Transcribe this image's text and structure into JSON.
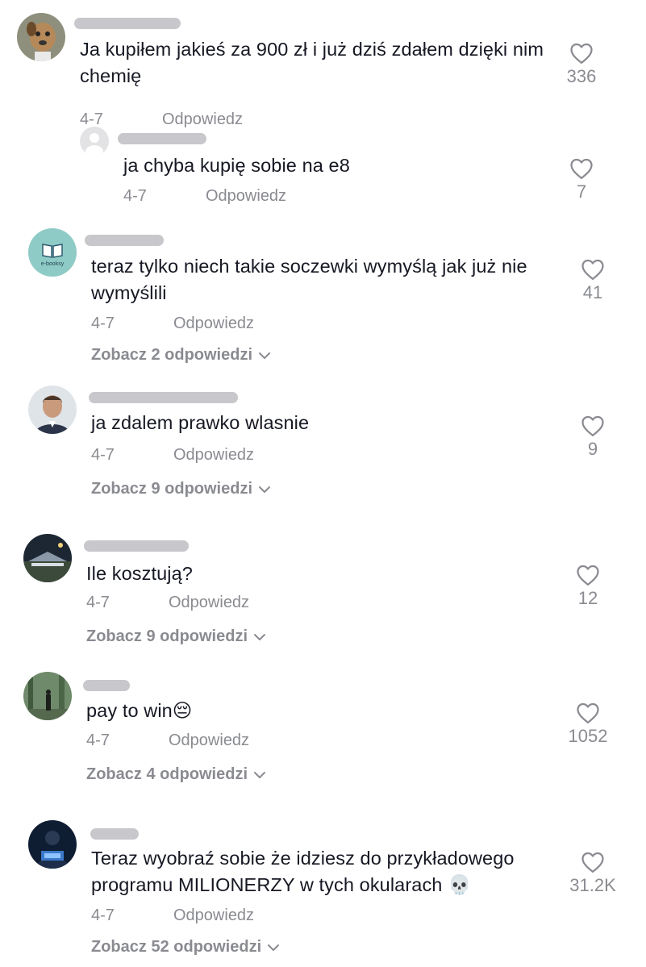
{
  "comments": [
    {
      "text": "Ja kupiłem jakieś za 900 zł i już dziś zdałem dzięki nim chemię",
      "date": "4-7",
      "reply_label": "Odpowiedz",
      "likes": "336",
      "replies": [
        {
          "text": "ja chyba kupię sobie na e8",
          "date": "4-7",
          "reply_label": "Odpowiedz",
          "likes": "7"
        }
      ]
    },
    {
      "text": "teraz tylko niech takie soczewki wymyślą jak już nie wymyślili",
      "date": "4-7",
      "reply_label": "Odpowiedz",
      "likes": "41",
      "avatar_label": "e-booksy",
      "view_replies": "Zobacz 2 odpowiedzi"
    },
    {
      "text": "ja zdalem prawko wlasnie",
      "date": "4-7",
      "reply_label": "Odpowiedz",
      "likes": "9",
      "view_replies": "Zobacz 9 odpowiedzi"
    },
    {
      "text": "Ile kosztują?",
      "date": "4-7",
      "reply_label": "Odpowiedz",
      "likes": "12",
      "view_replies": "Zobacz 9 odpowiedzi"
    },
    {
      "text": "pay to win😔",
      "date": "4-7",
      "reply_label": "Odpowiedz",
      "likes": "1052",
      "view_replies": "Zobacz 4 odpowiedzi"
    },
    {
      "text": "Teraz wyobraź sobie że idziesz do przykładowego programu MILIONERZY w tych okularach 💀",
      "date": "4-7",
      "reply_label": "Odpowiedz",
      "likes": "31.2K",
      "view_replies": "Zobacz 52 odpowiedzi"
    }
  ]
}
